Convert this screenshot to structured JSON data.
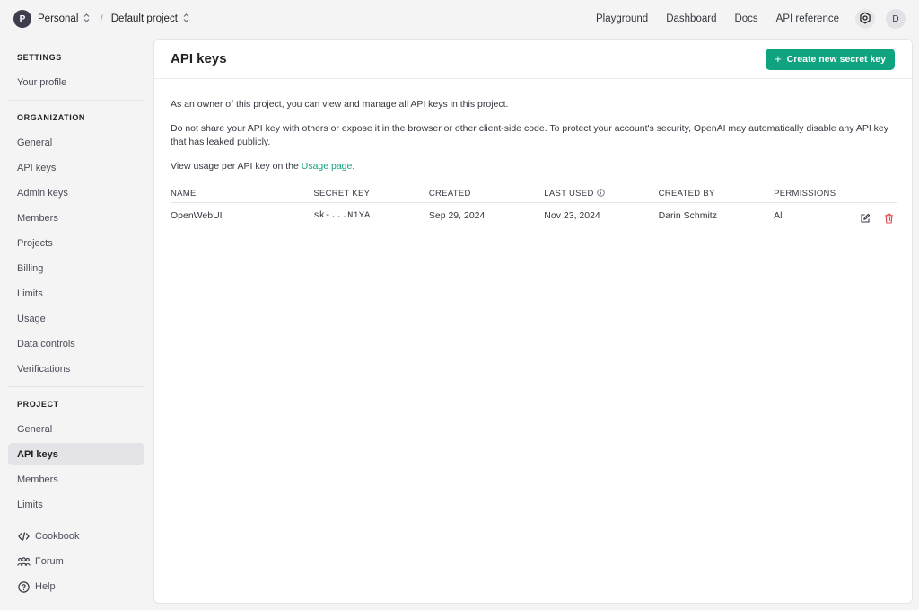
{
  "topbar": {
    "org_initial": "P",
    "org_name": "Personal",
    "separator": "/",
    "project_name": "Default project",
    "nav": [
      "Playground",
      "Dashboard",
      "Docs",
      "API reference"
    ],
    "user_initial": "D"
  },
  "sidebar": {
    "settings_heading": "SETTINGS",
    "settings_items": [
      "Your profile"
    ],
    "organization_heading": "ORGANIZATION",
    "organization_items": [
      "General",
      "API keys",
      "Admin keys",
      "Members",
      "Projects",
      "Billing",
      "Limits",
      "Usage",
      "Data controls",
      "Verifications"
    ],
    "project_heading": "PROJECT",
    "project_items": [
      "General",
      "API keys",
      "Members",
      "Limits"
    ],
    "active_item": "API keys",
    "footer": [
      {
        "label": "Cookbook",
        "icon": "code-icon"
      },
      {
        "label": "Forum",
        "icon": "people-icon"
      },
      {
        "label": "Help",
        "icon": "help-circle-icon"
      }
    ]
  },
  "main": {
    "title": "API keys",
    "create_button": "Create new secret key",
    "intro": "As an owner of this project, you can view and manage all API keys in this project.",
    "warning": "Do not share your API key with others or expose it in the browser or other client-side code. To protect your account's security, OpenAI may automatically disable any API key that has leaked publicly.",
    "usage_prefix": "View usage per API key on the ",
    "usage_link": "Usage page",
    "usage_suffix": ".",
    "table": {
      "columns": [
        "NAME",
        "SECRET KEY",
        "CREATED",
        "LAST USED",
        "CREATED BY",
        "PERMISSIONS"
      ],
      "rows": [
        {
          "name": "OpenWebUI",
          "secret": "sk-...N1YA",
          "created": "Sep 29, 2024",
          "last_used": "Nov 23, 2024",
          "created_by": "Darin Schmitz",
          "permissions": "All"
        }
      ]
    }
  },
  "colors": {
    "accent": "#10a37f",
    "danger": "#e5484d",
    "background": "#f4f4f5"
  }
}
